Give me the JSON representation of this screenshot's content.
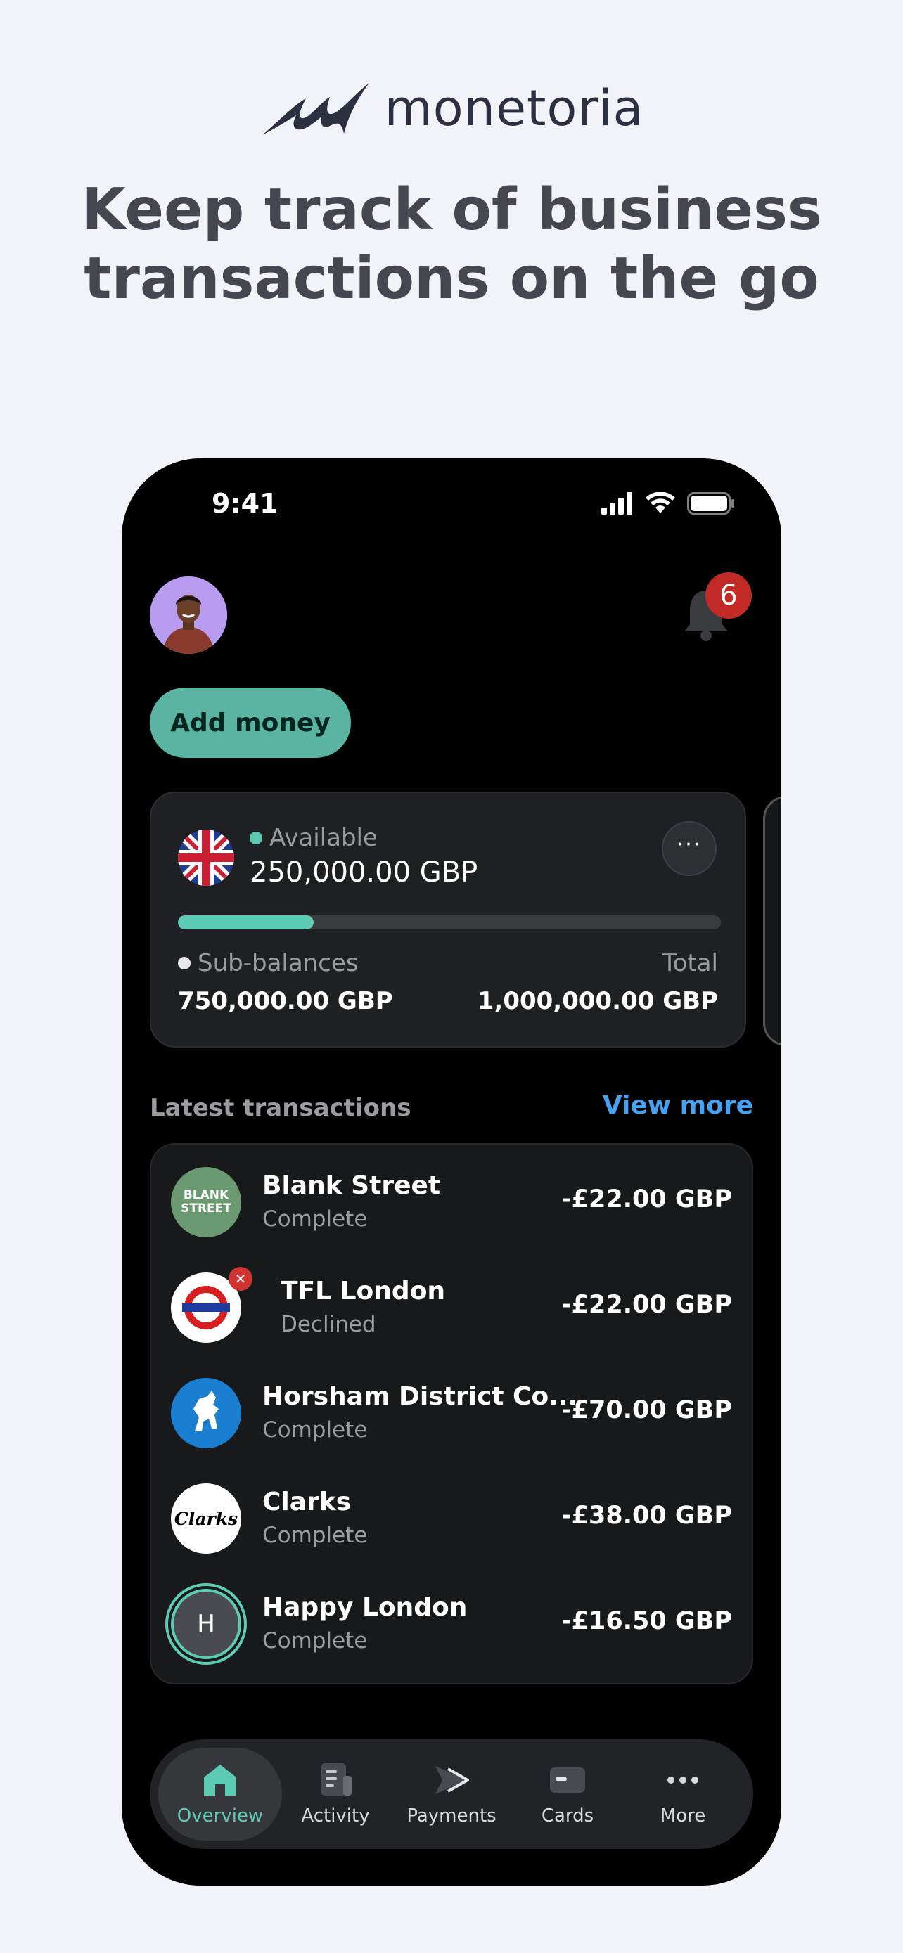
{
  "brand": {
    "name": "monetoria"
  },
  "headline": {
    "line1": "Keep track of business",
    "line2": "transactions on the go"
  },
  "status_bar": {
    "time": "9:41"
  },
  "header": {
    "notification_count": "6"
  },
  "actions": {
    "add_money": "Add money"
  },
  "balance": {
    "available_label": "Available",
    "available_value": "250,000.00 GBP",
    "available_fraction": 0.25,
    "sub_balances_label": "Sub-balances",
    "sub_balances_value": "750,000.00 GBP",
    "total_label": "Total",
    "total_value": "1,000,000.00 GBP",
    "more_glyph": "···"
  },
  "transactions": {
    "title": "Latest transactions",
    "view_more": "View more",
    "items": [
      {
        "name": "Blank Street",
        "status": "Complete",
        "amount": "-£22.00 GBP",
        "logo_text": "BLANK STREET"
      },
      {
        "name": "TFL London",
        "status": "Declined",
        "amount": "-£22.00 GBP",
        "logo_text": ""
      },
      {
        "name": "Horsham District Co...",
        "status": "Complete",
        "amount": "-£70.00 GBP",
        "logo_text": ""
      },
      {
        "name": "Clarks",
        "status": "Complete",
        "amount": "-£38.00 GBP",
        "logo_text": "Clarks"
      },
      {
        "name": "Happy London",
        "status": "Complete",
        "amount": "-£16.50 GBP",
        "logo_text": "H"
      }
    ]
  },
  "tabs": [
    {
      "label": "Overview",
      "icon": "home-icon",
      "active": true
    },
    {
      "label": "Activity",
      "icon": "activity-icon",
      "active": false
    },
    {
      "label": "Payments",
      "icon": "payments-icon",
      "active": false
    },
    {
      "label": "Cards",
      "icon": "card-icon",
      "active": false
    },
    {
      "label": "More",
      "icon": "more-icon",
      "active": false
    }
  ],
  "colors": {
    "accent": "#5dcab3",
    "button": "#5bb3a1",
    "link": "#45a2f0",
    "badge": "#c22a25",
    "background": "#000000"
  }
}
